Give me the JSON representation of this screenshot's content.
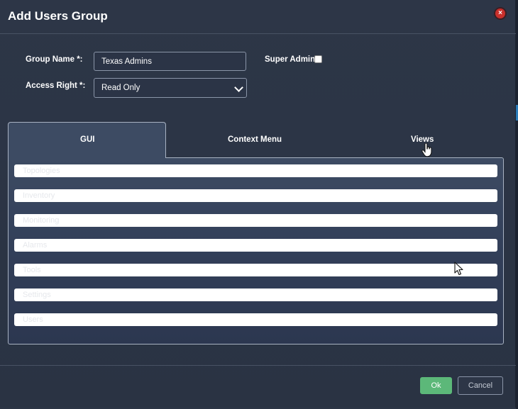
{
  "dialog": {
    "title": "Add Users Group",
    "close_icon": "close-icon",
    "close_glyph": "×"
  },
  "form": {
    "group_name_label": "Group Name *:",
    "group_name_value": "Texas Admins",
    "access_right_label": "Access Right *:",
    "access_right_value": "Read Only",
    "super_admin_label": "Super Admin:",
    "super_admin_checked": false
  },
  "tabs": [
    {
      "label": "GUI",
      "active": true
    },
    {
      "label": "Context Menu",
      "active": false
    },
    {
      "label": "Views",
      "active": false
    }
  ],
  "gui_items": [
    "Topologies",
    "Inventory",
    "Monitoring",
    "Alarms",
    "Tools",
    "Settings",
    "Users"
  ],
  "footer": {
    "ok_label": "Ok",
    "cancel_label": "Cancel"
  },
  "colors": {
    "background": "#2c3545",
    "tab_active": "#3d4b63",
    "ok_green": "#5cb879",
    "close_red": "#c9302c"
  }
}
